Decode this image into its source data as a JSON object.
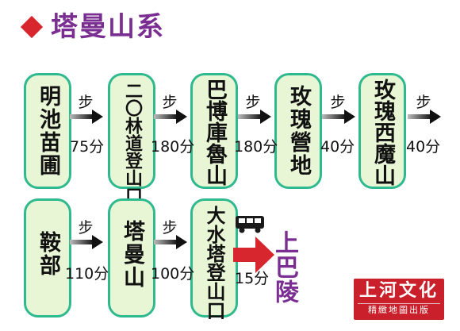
{
  "header": {
    "title": "塔曼山系"
  },
  "row1": [
    {
      "name": "明池苗圃"
    },
    {
      "mode": "步",
      "time": "75分"
    },
    {
      "name": "二〇林道登山口"
    },
    {
      "mode": "步",
      "time": "180分"
    },
    {
      "name": "巴博庫魯山"
    },
    {
      "mode": "步",
      "time": "180分"
    },
    {
      "name": "玫瑰營地"
    },
    {
      "mode": "步",
      "time": "40分"
    },
    {
      "name": "玫瑰西魔山"
    },
    {
      "mode": "步",
      "time": "40分"
    }
  ],
  "row2": [
    {
      "name": "鞍部"
    },
    {
      "mode": "步",
      "time": "110分"
    },
    {
      "name": "塔曼山"
    },
    {
      "mode": "步",
      "time": "100分"
    },
    {
      "name": "大水塔登山口"
    },
    {
      "mode": "bus-icon",
      "time": "15分"
    }
  ],
  "destination": "上巴陵",
  "logo": {
    "main": "上河文化",
    "sub": "精緻地圖出版"
  },
  "colors": {
    "title": "#7b2e91",
    "diamond": "#d8262e",
    "pill_fill": "#e9f6d6",
    "pill_border": "#2fb98f",
    "destination": "#7b2e91",
    "red_arrow": "#d8262e",
    "logo_bg": "#c9202b"
  }
}
